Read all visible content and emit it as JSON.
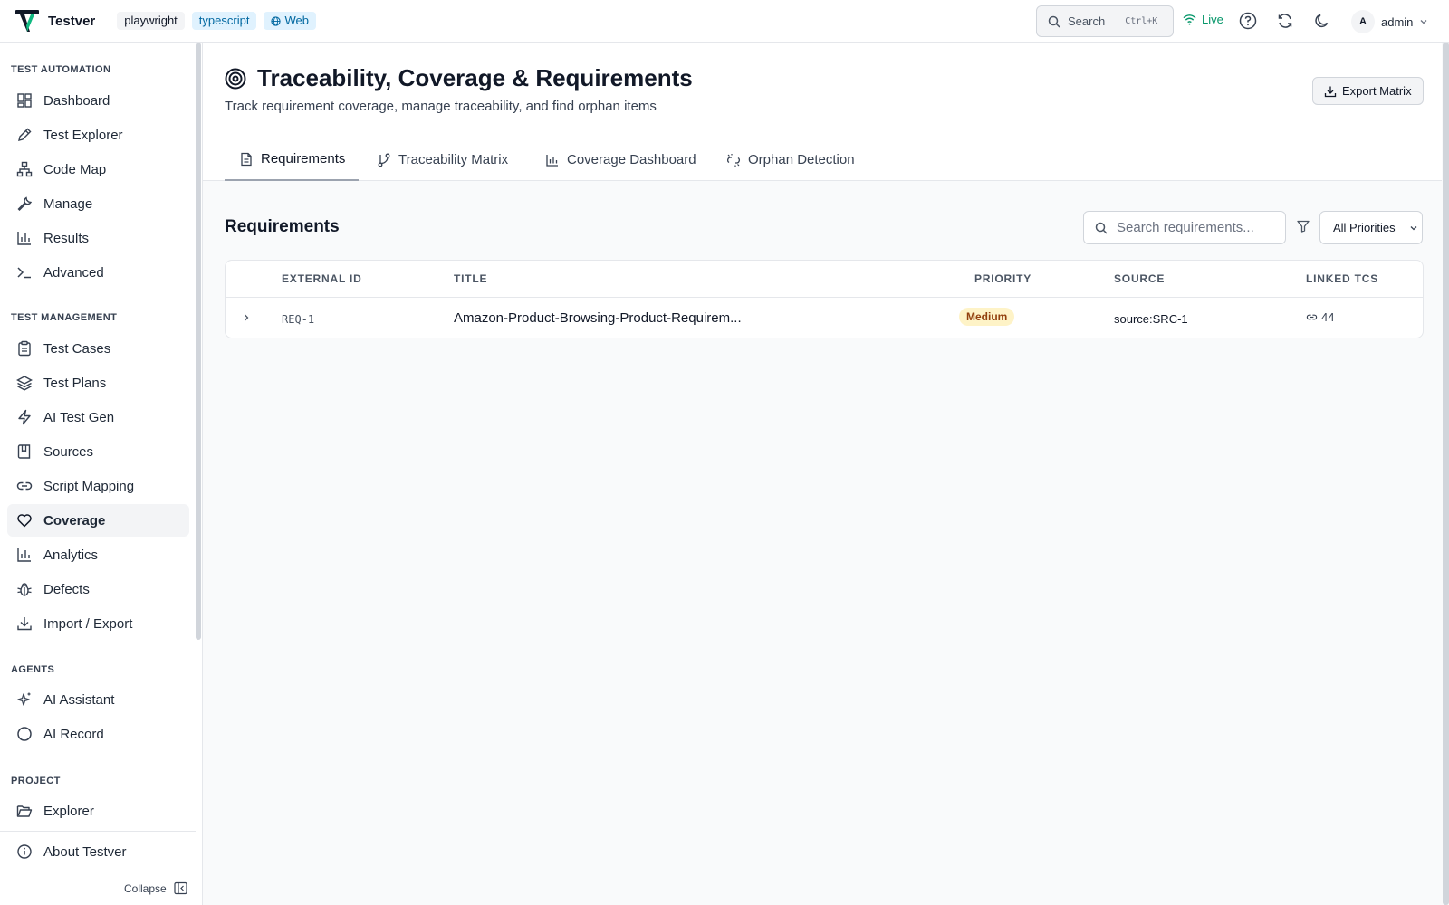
{
  "app": {
    "name": "Testver",
    "tags": [
      "playwright",
      "typescript",
      "Web"
    ]
  },
  "topbar": {
    "search_label": "Search",
    "search_shortcut": "Ctrl+K",
    "live_label": "Live",
    "user_initial": "A",
    "user_name": "admin"
  },
  "sidebar": {
    "sections": {
      "automation": "TEST AUTOMATION",
      "management": "TEST MANAGEMENT",
      "agents": "AGENTS",
      "project": "PROJECT"
    },
    "items": [
      {
        "label": "Dashboard",
        "icon": "dashboard-icon"
      },
      {
        "label": "Test Explorer",
        "icon": "pencil-icon"
      },
      {
        "label": "Code Map",
        "icon": "code-map-icon"
      },
      {
        "label": "Manage",
        "icon": "wrench-icon"
      },
      {
        "label": "Results",
        "icon": "bar-chart-icon"
      },
      {
        "label": "Advanced",
        "icon": "terminal-icon"
      },
      {
        "label": "Test Cases",
        "icon": "clipboard-icon"
      },
      {
        "label": "Test Plans",
        "icon": "layers-icon"
      },
      {
        "label": "AI Test Gen",
        "icon": "lightning-icon"
      },
      {
        "label": "Sources",
        "icon": "book-icon"
      },
      {
        "label": "Script Mapping",
        "icon": "link-icon"
      },
      {
        "label": "Coverage",
        "icon": "heart-icon"
      },
      {
        "label": "Analytics",
        "icon": "bar-chart-icon"
      },
      {
        "label": "Defects",
        "icon": "bug-icon"
      },
      {
        "label": "Import / Export",
        "icon": "download-icon"
      },
      {
        "label": "AI Assistant",
        "icon": "sparkles-icon"
      },
      {
        "label": "AI Record",
        "icon": "circle-icon"
      },
      {
        "label": "Explorer",
        "icon": "folder-icon"
      },
      {
        "label": "About Testver",
        "icon": "info-icon"
      }
    ],
    "active": "Coverage",
    "collapse_label": "Collapse"
  },
  "page": {
    "title": "Traceability, Coverage & Requirements",
    "subtitle": "Track requirement coverage, manage traceability, and find orphan items",
    "export_label": "Export Matrix",
    "tabs": [
      "Requirements",
      "Traceability Matrix",
      "Coverage Dashboard",
      "Orphan Detection"
    ],
    "active_tab": "Requirements"
  },
  "requirements": {
    "heading": "Requirements",
    "search_placeholder": "Search requirements...",
    "priority_filter": "All Priorities",
    "columns": [
      "EXTERNAL ID",
      "TITLE",
      "PRIORITY",
      "SOURCE",
      "LINKED TCS"
    ],
    "rows": [
      {
        "external_id": "REQ-1",
        "title": "Amazon-Product-Browsing-Product-Requirem...",
        "priority": "Medium",
        "source": "source:SRC-1",
        "linked_tcs": "44"
      }
    ]
  },
  "colors": {
    "accent_live": "#059669",
    "priority_medium_bg": "#fef3c7",
    "priority_medium_text": "#92400e",
    "tag_bg": "#e0f2fe"
  }
}
